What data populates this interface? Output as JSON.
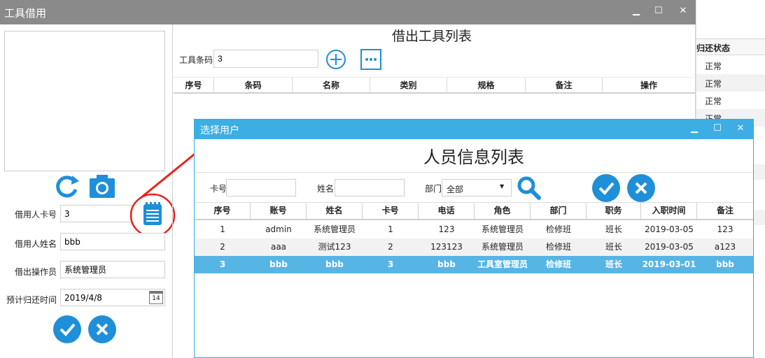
{
  "background_window": {
    "header": "归还状态",
    "rows": [
      "正常",
      "正常",
      "正常",
      "正常"
    ]
  },
  "main_window": {
    "title": "工具借用",
    "controls": {
      "minimize": "▁",
      "maximize": "☐",
      "close": "✕"
    }
  },
  "borrower_form": {
    "card_label": "借用人卡号",
    "card_value": "3",
    "name_label": "借用人姓名",
    "name_value": "bbb",
    "operator_label": "借出操作员",
    "operator_value": "系统管理员",
    "return_time_label": "预计归还时间",
    "return_time_value": "2019/4/8",
    "calendar_day": "14"
  },
  "borrow_list": {
    "title": "借出工具列表",
    "tool_code_label": "工具条码",
    "tool_code_value": "3",
    "columns": [
      "序号",
      "条码",
      "名称",
      "类别",
      "规格",
      "备注",
      "操作"
    ]
  },
  "dialog": {
    "title": "选择用户",
    "heading": "人员信息列表",
    "controls": {
      "minimize": "▁",
      "maximize": "☐",
      "close": "✕"
    },
    "search": {
      "card_label": "卡号",
      "card_value": "",
      "name_label": "姓名",
      "name_value": "",
      "dept_label": "部门",
      "dept_selected": "全部"
    },
    "columns": [
      "序号",
      "账号",
      "姓名",
      "卡号",
      "电话",
      "角色",
      "部门",
      "职务",
      "入职时间",
      "备注"
    ],
    "rows": [
      [
        "1",
        "admin",
        "系统管理员",
        "1",
        "123",
        "系统管理员",
        "检修班",
        "班长",
        "2019-03-05",
        "123"
      ],
      [
        "2",
        "aaa",
        "测试123",
        "2",
        "123123",
        "系统管理员",
        "检修班",
        "班长",
        "2019-03-05",
        "a123"
      ],
      [
        "3",
        "bbb",
        "bbb",
        "3",
        "bbb",
        "工具室管理员",
        "检修班",
        "班长",
        "2019-03-01",
        "bbb"
      ]
    ],
    "selected_row": 2
  },
  "colors": {
    "accent": "#1e8fd8",
    "dialog_title": "#3daee3",
    "selected_row": "#57b5e5",
    "annotation": "#e8231b",
    "main_titlebar": "#8a8a8a"
  }
}
